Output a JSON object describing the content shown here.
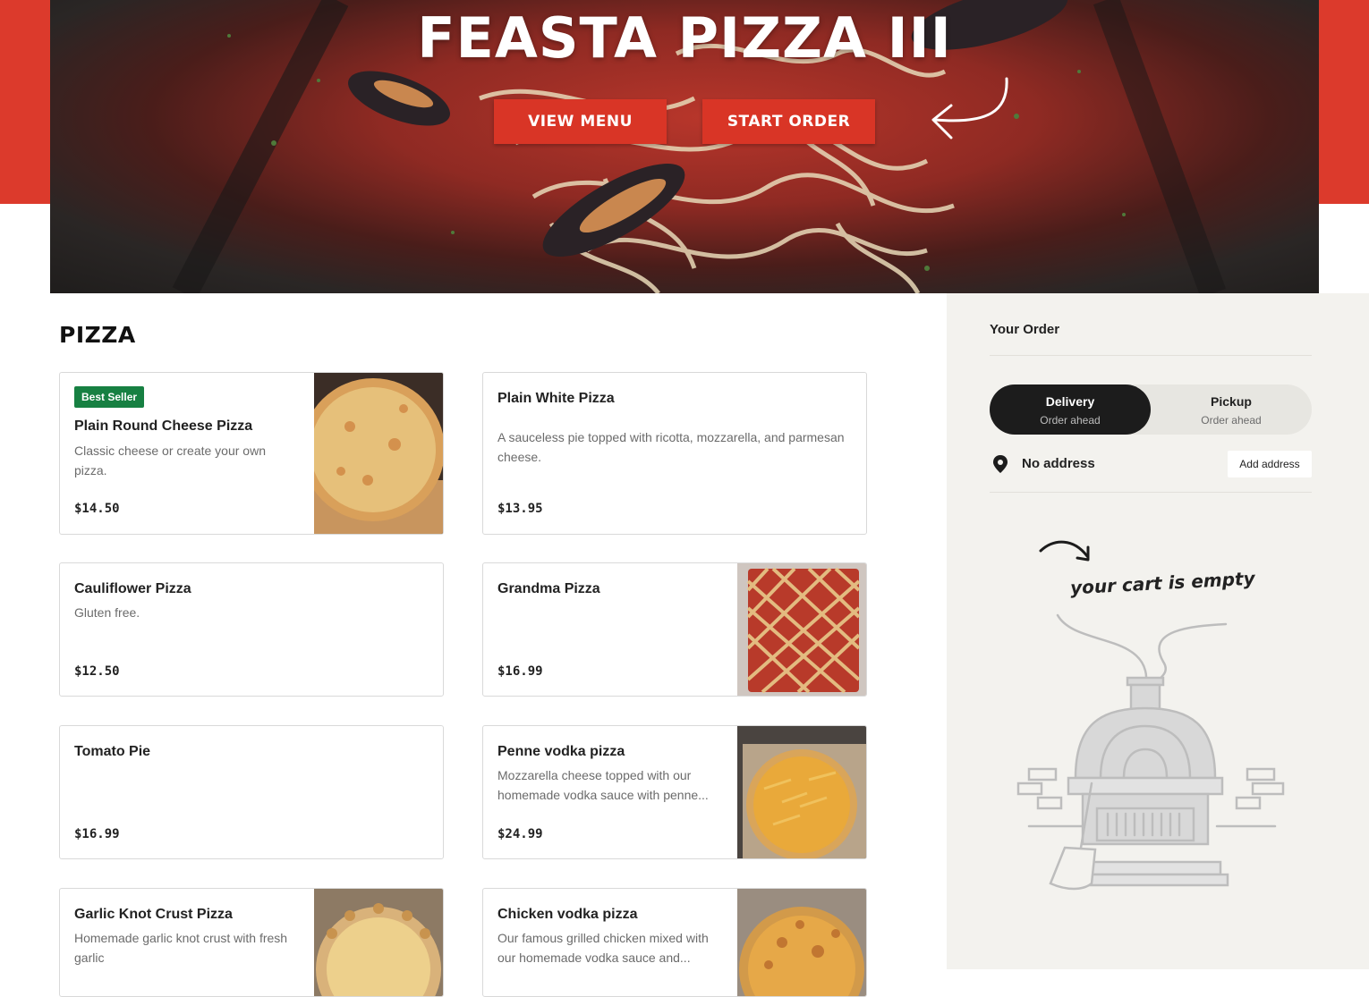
{
  "hero": {
    "title": "FEASTA PIZZA III",
    "view_menu_label": "VIEW MENU",
    "start_order_label": "START ORDER"
  },
  "menu": {
    "section_title": "PIZZA",
    "items": [
      {
        "badge": "Best Seller",
        "name": "Plain Round Cheese Pizza",
        "description": "Classic cheese or create your own pizza.",
        "price": "$14.50",
        "has_image": true
      },
      {
        "name": "Plain White Pizza",
        "description": "A sauceless pie topped with ricotta, mozzarella, and parmesan cheese.",
        "price": "$13.95",
        "has_image": false
      },
      {
        "name": "Cauliflower Pizza",
        "description": "Gluten free.",
        "price": "$12.50",
        "has_image": false
      },
      {
        "name": "Grandma Pizza",
        "description": "",
        "price": "$16.99",
        "has_image": true
      },
      {
        "name": "Tomato Pie",
        "description": "",
        "price": "$16.99",
        "has_image": false
      },
      {
        "name": "Penne vodka pizza",
        "description": "Mozzarella cheese topped with our homemade vodka sauce with penne...",
        "price": "$24.99",
        "has_image": true
      },
      {
        "name": "Garlic Knot Crust Pizza",
        "description": "Homemade garlic knot crust with fresh garlic",
        "price": "",
        "has_image": true
      },
      {
        "name": "Chicken vodka pizza",
        "description": "Our famous grilled chicken mixed with our homemade vodka sauce and...",
        "price": "",
        "has_image": true
      }
    ]
  },
  "order": {
    "title": "Your Order",
    "delivery_label": "Delivery",
    "delivery_sub": "Order ahead",
    "pickup_label": "Pickup",
    "pickup_sub": "Order ahead",
    "selected_mode": "Delivery",
    "address_text": "No address",
    "add_address_label": "Add address",
    "cart_empty_text": "your cart is empty"
  },
  "colors": {
    "brand_red": "#dc3a2c",
    "button_red": "#d93526",
    "badge_green": "#178042",
    "toggle_active": "#1c1c1c",
    "sidebar_bg": "#f3f2ee"
  },
  "icons": [
    "location-pin-icon",
    "curved-arrow-icon",
    "pizza-oven-illustration"
  ]
}
